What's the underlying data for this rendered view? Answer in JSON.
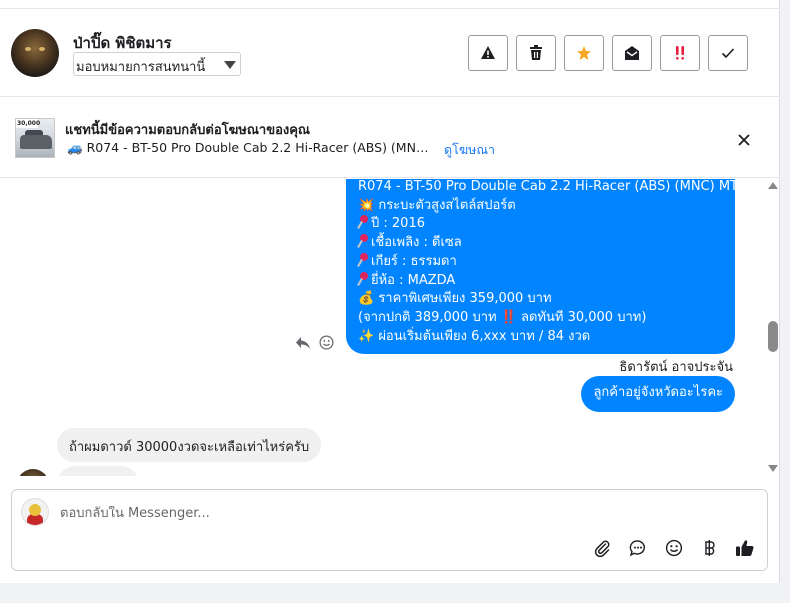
{
  "header": {
    "user_name": "ป่าปิ๊ด พิชิตมาร",
    "assign_label": "มอบหมายการสนทนานี้",
    "actions": [
      "spam-report",
      "delete",
      "star",
      "mark-unread",
      "follow-up",
      "done"
    ]
  },
  "ad": {
    "title": "แชทนี้มีข้อความตอบกลับต่อโฆษณาของคุณ",
    "vehicle_emoji": "🚙",
    "subtitle": "R074 - BT-50 Pro Double Cab 2.2 Hi-Racer (ABS) (MNC) MT ...",
    "link": "ดูโฆษณา",
    "thumb_tag": "30,000"
  },
  "messages": {
    "outgoing_lines": [
      "R074 - BT-50 Pro Double Cab 2.2 Hi-Racer (ABS) (MNC) MT",
      "💥 กระบะตัวสูงสไตล์สปอร์ต",
      "ปี : 2016",
      "เชื้อเพลิง : ดีเซล",
      "เกียร์ : ธรรมดา",
      "ยี่ห้อ : MAZDA",
      "💰 ราคาพิเศษเพียง 359,000 บาท",
      "(จากปกติ 389,000 บาท ‼️ ลดทันที 30,000 บาท)",
      "✨ ผ่อนเริ่มต้นเพียง 6,xxx บาท / 84 งวด"
    ],
    "sender_name": "ธิดารัตน์ อาจประจัน",
    "outgoing_short": "ลูกค้าอยู่จังหวัดอะไรคะ",
    "incoming": "ถ้าผมดาวด์ 30000งวดจะเหลือเท่าไหร่ครับ"
  },
  "composer": {
    "placeholder": "ตอบกลับใน Messenger..."
  },
  "colors": {
    "accent": "#0084ff",
    "link": "#1877f2",
    "star": "#f5a623",
    "alert": "#e41e3f"
  }
}
